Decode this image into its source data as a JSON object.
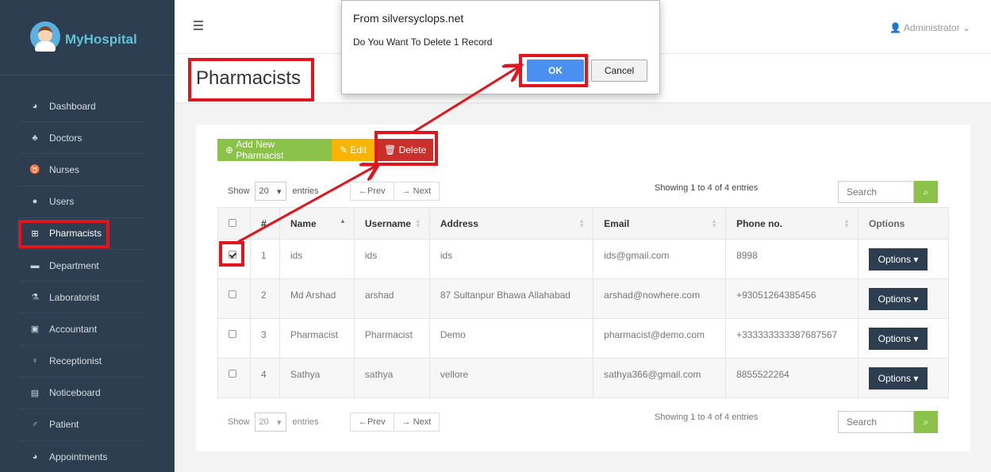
{
  "app": {
    "name": "MyHospital"
  },
  "sidebar": {
    "items": [
      {
        "label": "Dashboard",
        "icon": "dashboard-icon"
      },
      {
        "label": "Doctors",
        "icon": "doctor-icon"
      },
      {
        "label": "Nurses",
        "icon": "stethoscope-icon"
      },
      {
        "label": "Users",
        "icon": "user-icon"
      },
      {
        "label": "Pharmacists",
        "icon": "plus-square-icon",
        "active": true
      },
      {
        "label": "Department",
        "icon": "briefcase-icon"
      },
      {
        "label": "Laboratorist",
        "icon": "flask-icon"
      },
      {
        "label": "Accountant",
        "icon": "money-icon"
      },
      {
        "label": "Receptionist",
        "icon": "female-icon"
      },
      {
        "label": "Noticeboard",
        "icon": "file-icon"
      },
      {
        "label": "Patient",
        "icon": "male-icon"
      },
      {
        "label": "Appointments",
        "icon": "dashboard-icon"
      }
    ]
  },
  "topbar": {
    "user": "Administrator"
  },
  "page": {
    "title": "Pharmacists"
  },
  "toolbar": {
    "add_label": "Add New Pharmacist",
    "edit_label": "Edit",
    "delete_label": "Delete"
  },
  "controls": {
    "show_label": "Show",
    "page_size": "20",
    "entries_label": "entries",
    "prev_label": "←Prev",
    "next_label": "→ Next",
    "info": "Showing 1 to 4 of 4 entries",
    "search_placeholder": "Search"
  },
  "table": {
    "headers": [
      "#",
      "Name",
      "Username",
      "Address",
      "Email",
      "Phone no.",
      "Options"
    ],
    "rows": [
      {
        "num": "1",
        "name": "ids",
        "username": "ids",
        "address": "ids",
        "email": "ids@gmail.com",
        "phone": "8998",
        "checked": true
      },
      {
        "num": "2",
        "name": "Md Arshad",
        "username": "arshad",
        "address": "87 Sultanpur Bhawa Allahabad",
        "email": "arshad@nowhere.com",
        "phone": "+93051264385456",
        "checked": false
      },
      {
        "num": "3",
        "name": "Pharmacist",
        "username": "Pharmacist",
        "address": "Demo",
        "email": "pharmacist@demo.com",
        "phone": "+333333333387687567",
        "checked": false
      },
      {
        "num": "4",
        "name": "Sathya",
        "username": "sathya",
        "address": "vellore",
        "email": "sathya366@gmail.com",
        "phone": "8855522264",
        "checked": false
      }
    ],
    "options_label": "Options"
  },
  "dialog": {
    "title": "From silversyclops.net",
    "message": "Do You Want To Delete 1 Record",
    "ok_label": "OK",
    "cancel_label": "Cancel"
  },
  "colors": {
    "sidebar": "#2c3e50",
    "add": "#8bc34a",
    "edit": "#f7b500",
    "delete": "#c9302c",
    "ok": "#4a90f0",
    "annotation": "#e0161f"
  }
}
